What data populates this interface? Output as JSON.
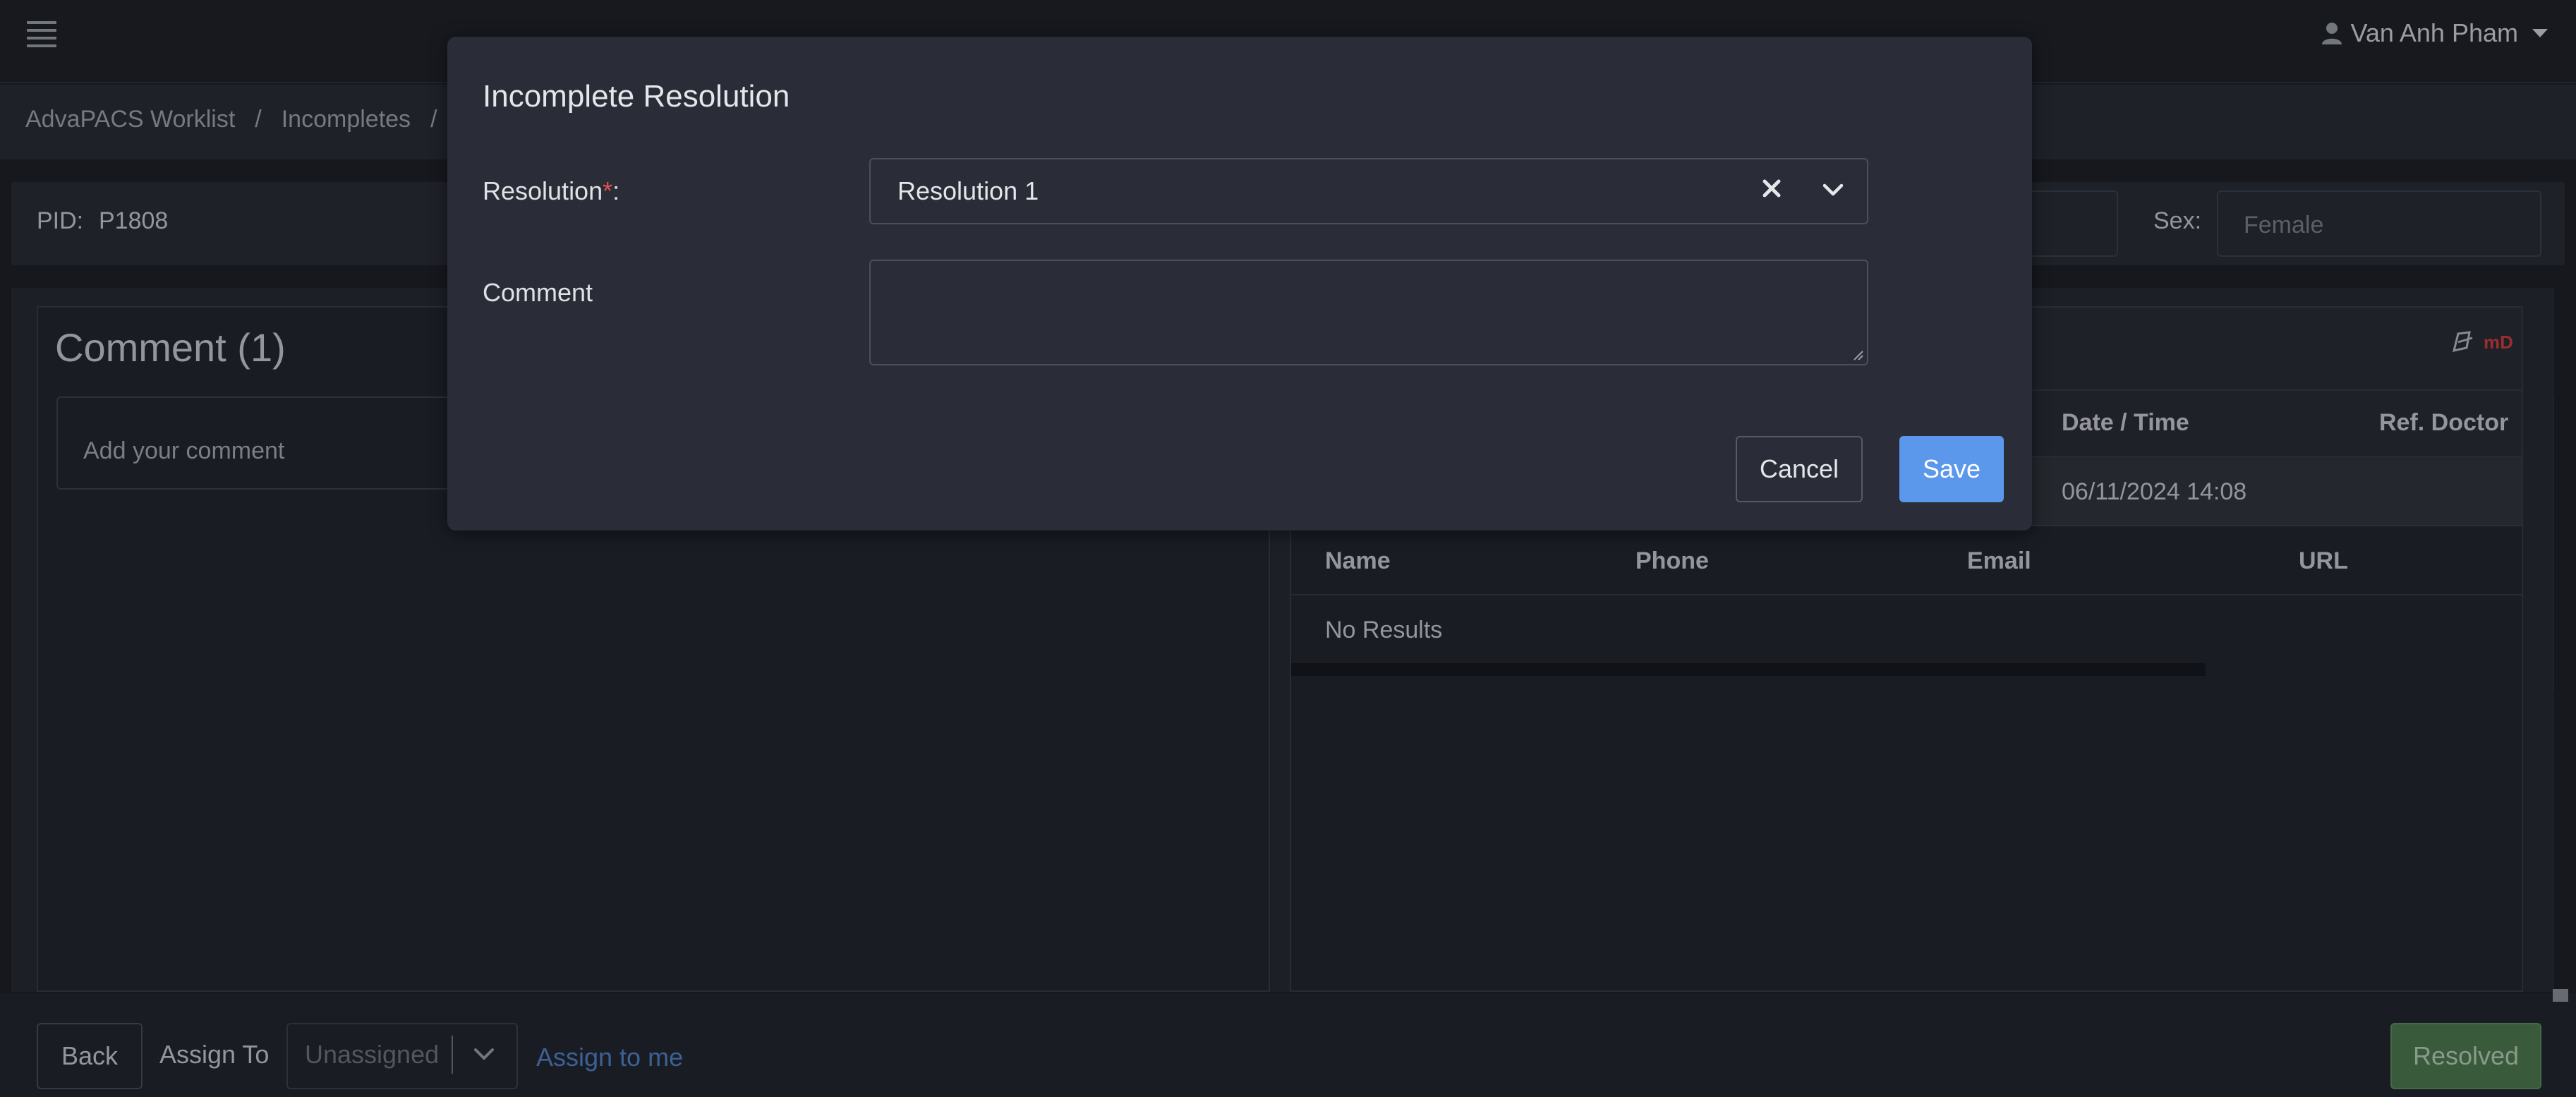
{
  "header": {
    "user_name": "Van Anh Pham",
    "icons": [
      "menu-icon",
      "user-icon",
      "caret-down-icon"
    ]
  },
  "breadcrumb": {
    "items": [
      "AdvaPACS Worklist",
      "Incompletes"
    ],
    "separator": "/"
  },
  "patient": {
    "pid_label": "PID:",
    "pid_value": "P1808",
    "sex_label": "Sex:",
    "sex_placeholder": "Female"
  },
  "comments": {
    "title": "Comment (1)",
    "input_placeholder": "Add your comment"
  },
  "study_table": {
    "headers": [
      "Date / Time",
      "Ref. Doctor"
    ],
    "rows": [
      [
        "06/11/2024 14:08",
        ""
      ]
    ]
  },
  "contacts_table": {
    "headers": [
      "Name",
      "Phone",
      "Email",
      "URL"
    ],
    "empty_text": "No Results"
  },
  "logo_text": "mD",
  "footer": {
    "back_label": "Back",
    "assign_label": "Assign To",
    "assign_placeholder": "Unassigned",
    "assign_me_label": "Assign to me",
    "resolved_label": "Resolved"
  },
  "modal": {
    "title": "Incomplete Resolution",
    "resolution_label": "Resolution",
    "required_mark": "*",
    "label_colon": ":",
    "resolution_value": "Resolution 1",
    "comment_label": "Comment",
    "comment_value": "",
    "cancel_label": "Cancel",
    "save_label": "Save"
  },
  "colors": {
    "background": "#1b1e25",
    "modal": "#2a2d37",
    "primary": "#5b97ea",
    "success": "#4c7a4e",
    "required": "#e0524f",
    "link": "#4f83c9"
  }
}
